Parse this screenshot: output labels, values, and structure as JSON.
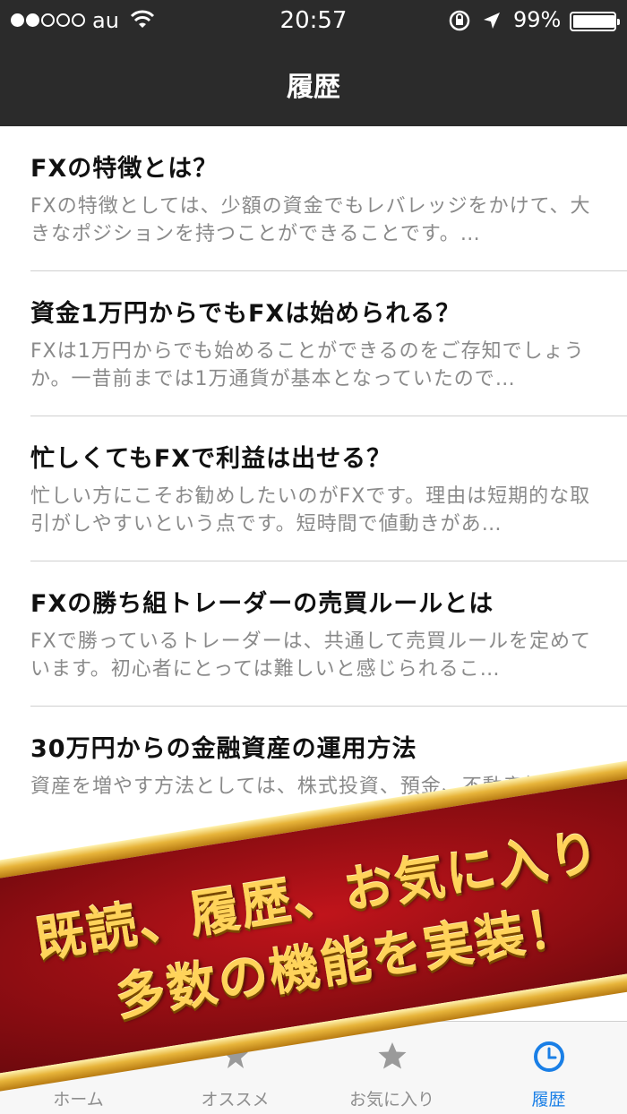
{
  "status_bar": {
    "carrier": "au",
    "time": "20:57",
    "battery_percent": "99%",
    "battery_level": 0.99,
    "signal_bars_filled": 2,
    "signal_bars_total": 5
  },
  "nav": {
    "title": "履歴"
  },
  "articles": [
    {
      "title": "FXの特徴とは？",
      "excerpt": "FXの特徴としては、少額の資金でもレバレッジをかけて、大きなポジションを持つことができることです。…"
    },
    {
      "title": "資金1万円からでもFXは始められる？",
      "excerpt": "FXは1万円からでも始めることができるのをご存知でしょうか。一昔前までは1万通貨が基本となっていたので…"
    },
    {
      "title": "忙しくてもFXで利益は出せる？",
      "excerpt": "忙しい方にこそお勧めしたいのがFXです。理由は短期的な取引がしやすいという点です。短時間で値動きがあ…"
    },
    {
      "title": "FXの勝ち組トレーダーの売買ルールとは",
      "excerpt": "FXで勝っているトレーダーは、共通して売買ルールを定めています。初心者にとっては難しいと感じられるこ…"
    },
    {
      "title": "30万円からの金融資産の運用方法",
      "excerpt": "資産を増やす方法としては、株式投資、預金、不動産投資"
    }
  ],
  "tabs": [
    {
      "label": "ホーム",
      "icon": "home-icon",
      "active": false
    },
    {
      "label": "オススメ",
      "icon": "recommend-icon",
      "active": false
    },
    {
      "label": "お気に入り",
      "icon": "star-icon",
      "active": false
    },
    {
      "label": "履歴",
      "icon": "clock-icon",
      "active": true
    }
  ],
  "promo": {
    "line1": "既読、履歴、お気に入り",
    "line2": "多数の機能を実装！"
  },
  "colors": {
    "nav_background": "#2b2b2b",
    "tab_active": "#1a7fe6",
    "banner_red": "#a8121a",
    "banner_gold": "#e7b43a"
  }
}
